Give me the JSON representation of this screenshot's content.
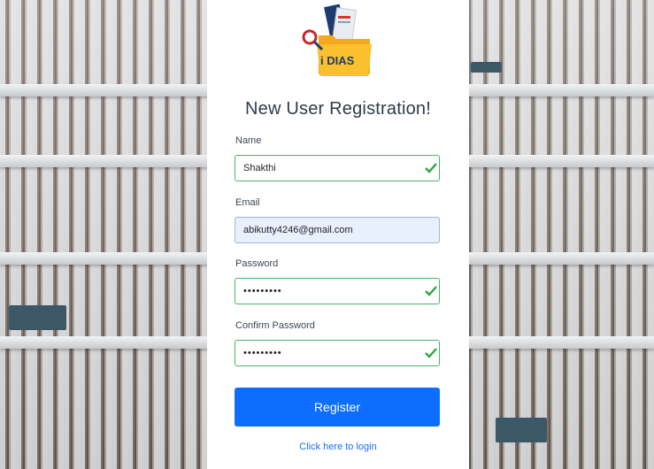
{
  "brand": {
    "logo_text": "i DIAS"
  },
  "form": {
    "title": "New User Registration!",
    "name_label": "Name",
    "name_value": "Shakthi",
    "email_label": "Email",
    "email_value": "abikutty4246@gmail.com",
    "password_label": "Password",
    "password_value": "•••••••••",
    "confirm_label": "Confirm Password",
    "confirm_value": "•••••••••",
    "register_label": "Register",
    "login_link": "Click here to login"
  },
  "colors": {
    "primary": "#0d6efd",
    "valid": "#28a745",
    "link": "#1a6ef2"
  }
}
